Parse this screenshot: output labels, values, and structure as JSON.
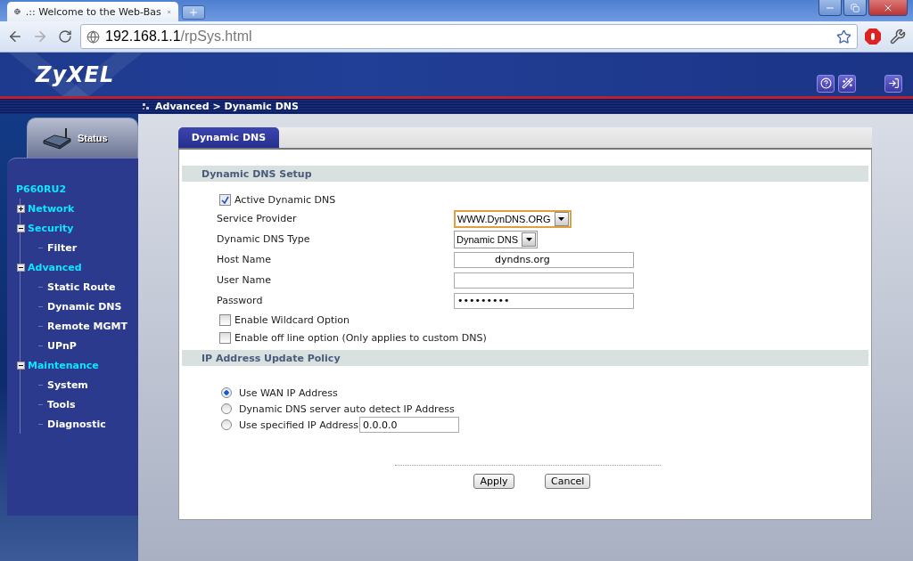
{
  "browser": {
    "tab_title": ".:: Welcome to the Web-Bas",
    "url_host": "192.168.1.1",
    "url_path": "/rpSys.html"
  },
  "header": {
    "logo": "ZyXEL",
    "breadcrumb": "Advanced > Dynamic DNS"
  },
  "sidebar": {
    "status_tab": "Status",
    "model": "P660RU2",
    "tree": [
      {
        "label": "Network",
        "expanded": false
      },
      {
        "label": "Security",
        "expanded": true,
        "children": [
          {
            "label": "Filter"
          }
        ]
      },
      {
        "label": "Advanced",
        "expanded": true,
        "children": [
          {
            "label": "Static Route"
          },
          {
            "label": "Dynamic DNS"
          },
          {
            "label": "Remote MGMT"
          },
          {
            "label": "UPnP"
          }
        ]
      },
      {
        "label": "Maintenance",
        "expanded": true,
        "children": [
          {
            "label": "System"
          },
          {
            "label": "Tools"
          },
          {
            "label": "Diagnostic"
          }
        ]
      }
    ]
  },
  "content": {
    "tab": "Dynamic DNS",
    "setup": {
      "title": "Dynamic DNS Setup",
      "rows": [
        {
          "kind": "checkbox",
          "label": "Active Dynamic DNS",
          "checked": true
        },
        {
          "kind": "select",
          "label": "Service Provider",
          "value": "WWW.DynDNS.ORG",
          "focused": true
        },
        {
          "kind": "select",
          "label": "Dynamic DNS Type",
          "value": "Dynamic DNS",
          "focused": false
        },
        {
          "kind": "text",
          "label": "Host Name",
          "value": "            dyndns.org"
        },
        {
          "kind": "text",
          "label": "User Name"
        },
        {
          "kind": "password",
          "label": "Password",
          "value": "•••••••••"
        },
        {
          "kind": "checkbox",
          "label": "Enable Wildcard Option",
          "checked": false
        },
        {
          "kind": "checkbox",
          "label": "Enable off line option (Only applies to custom DNS)",
          "checked": false
        }
      ]
    },
    "policy": {
      "title": "IP Address Update Policy",
      "options": [
        {
          "label": "Use WAN IP Address",
          "selected": true
        },
        {
          "label": "Dynamic DNS server auto detect IP Address",
          "selected": false
        },
        {
          "label": "Use specified IP Address",
          "selected": false,
          "value": "0.0.0.0"
        }
      ]
    },
    "buttons": [
      "Apply",
      "Cancel"
    ]
  }
}
